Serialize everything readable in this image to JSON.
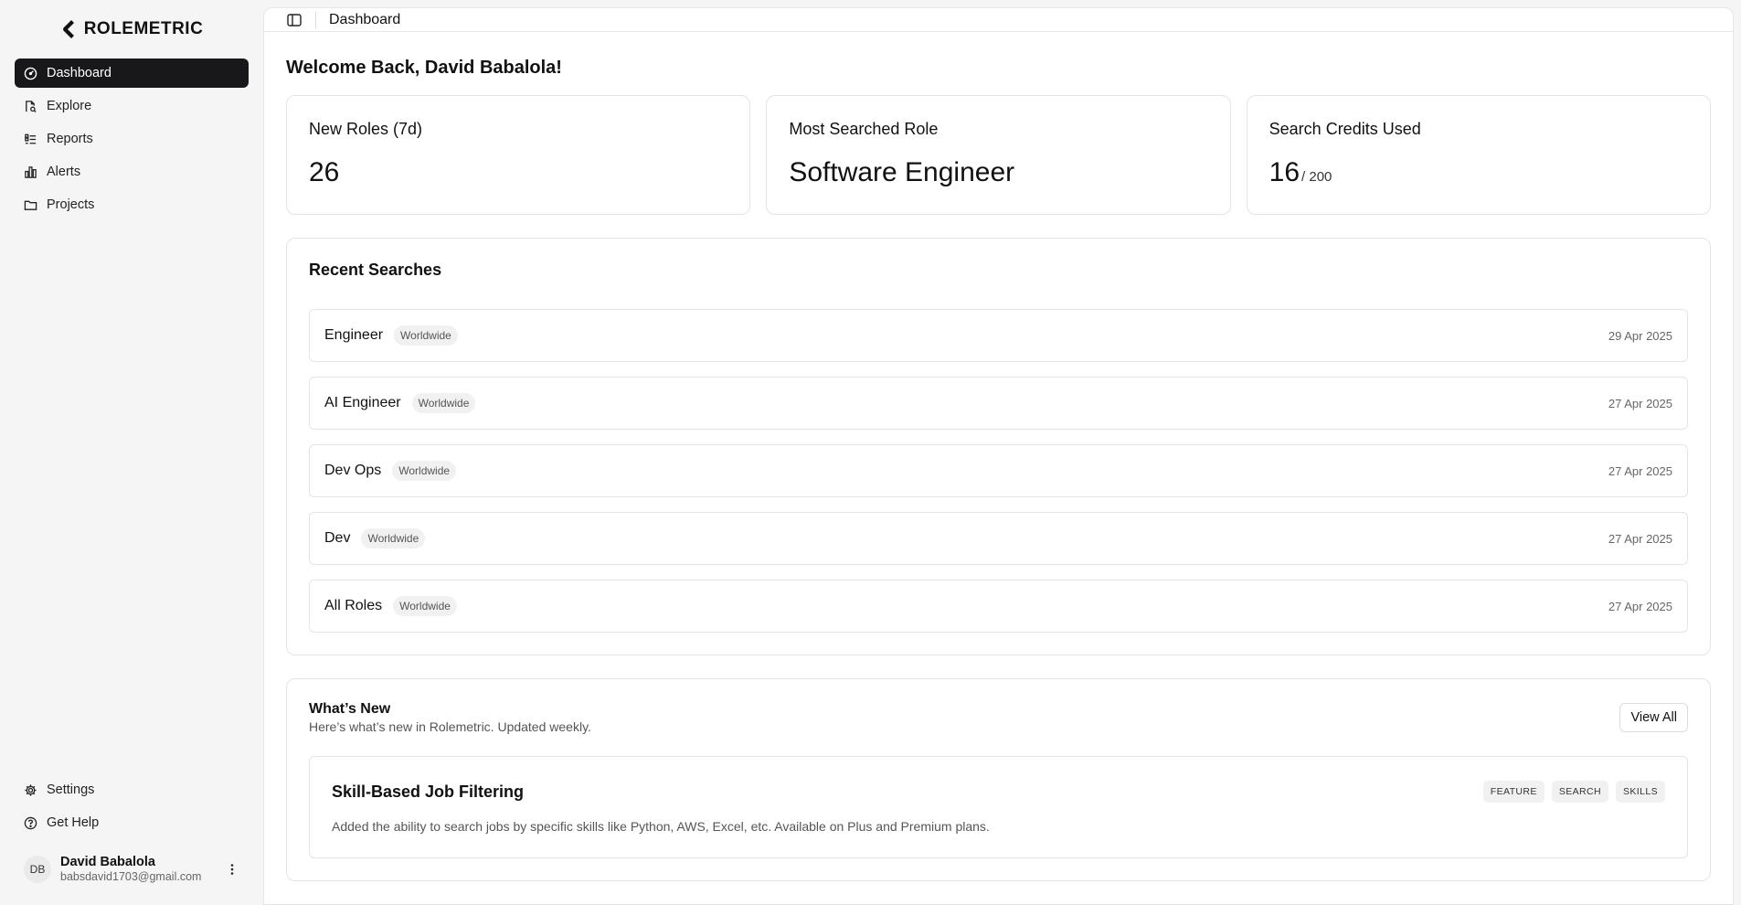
{
  "brand": {
    "name": "ROLEMETRIC"
  },
  "sidebar": {
    "items": [
      {
        "label": "Dashboard",
        "icon": "gauge-icon",
        "active": true
      },
      {
        "label": "Explore",
        "icon": "search-file-icon"
      },
      {
        "label": "Reports",
        "icon": "list-icon"
      },
      {
        "label": "Alerts",
        "icon": "bar-chart-icon"
      },
      {
        "label": "Projects",
        "icon": "folder-icon"
      }
    ],
    "bottom": [
      {
        "label": "Settings",
        "icon": "gear-icon"
      },
      {
        "label": "Get Help",
        "icon": "help-circle-icon"
      }
    ],
    "user": {
      "initials": "DB",
      "name": "David Babalola",
      "email": "babsdavid1703@gmail.com"
    }
  },
  "topbar": {
    "breadcrumb": "Dashboard"
  },
  "main": {
    "welcome": "Welcome Back, David Babalola!",
    "stats": [
      {
        "title": "New Roles (7d)",
        "value": "26",
        "sub": ""
      },
      {
        "title": "Most Searched Role",
        "value": "Software Engineer",
        "sub": ""
      },
      {
        "title": "Search Credits Used",
        "value": "16",
        "sub": "/ 200"
      }
    ],
    "recent": {
      "title": "Recent Searches",
      "rows": [
        {
          "term": "Engineer",
          "region": "Worldwide",
          "date": "29 Apr 2025"
        },
        {
          "term": "AI Engineer",
          "region": "Worldwide",
          "date": "27 Apr 2025"
        },
        {
          "term": "Dev Ops",
          "region": "Worldwide",
          "date": "27 Apr 2025"
        },
        {
          "term": "Dev",
          "region": "Worldwide",
          "date": "27 Apr 2025"
        },
        {
          "term": "All Roles",
          "region": "Worldwide",
          "date": "27 Apr 2025"
        }
      ]
    },
    "whats_new": {
      "title": "What’s New",
      "subtitle": "Here’s what’s new in Rolemetric. Updated weekly.",
      "view_all": "View All",
      "features": [
        {
          "title": "Skill-Based Job Filtering",
          "tags": [
            "FEATURE",
            "SEARCH",
            "SKILLS"
          ],
          "description": "Added the ability to search jobs by specific skills like Python, AWS, Excel, etc. Available on Plus and Premium plans."
        }
      ]
    }
  },
  "colors": {
    "active_nav_bg": "#18181b",
    "page_bg": "#f5f5f5",
    "card_border": "#e4e4e4"
  }
}
